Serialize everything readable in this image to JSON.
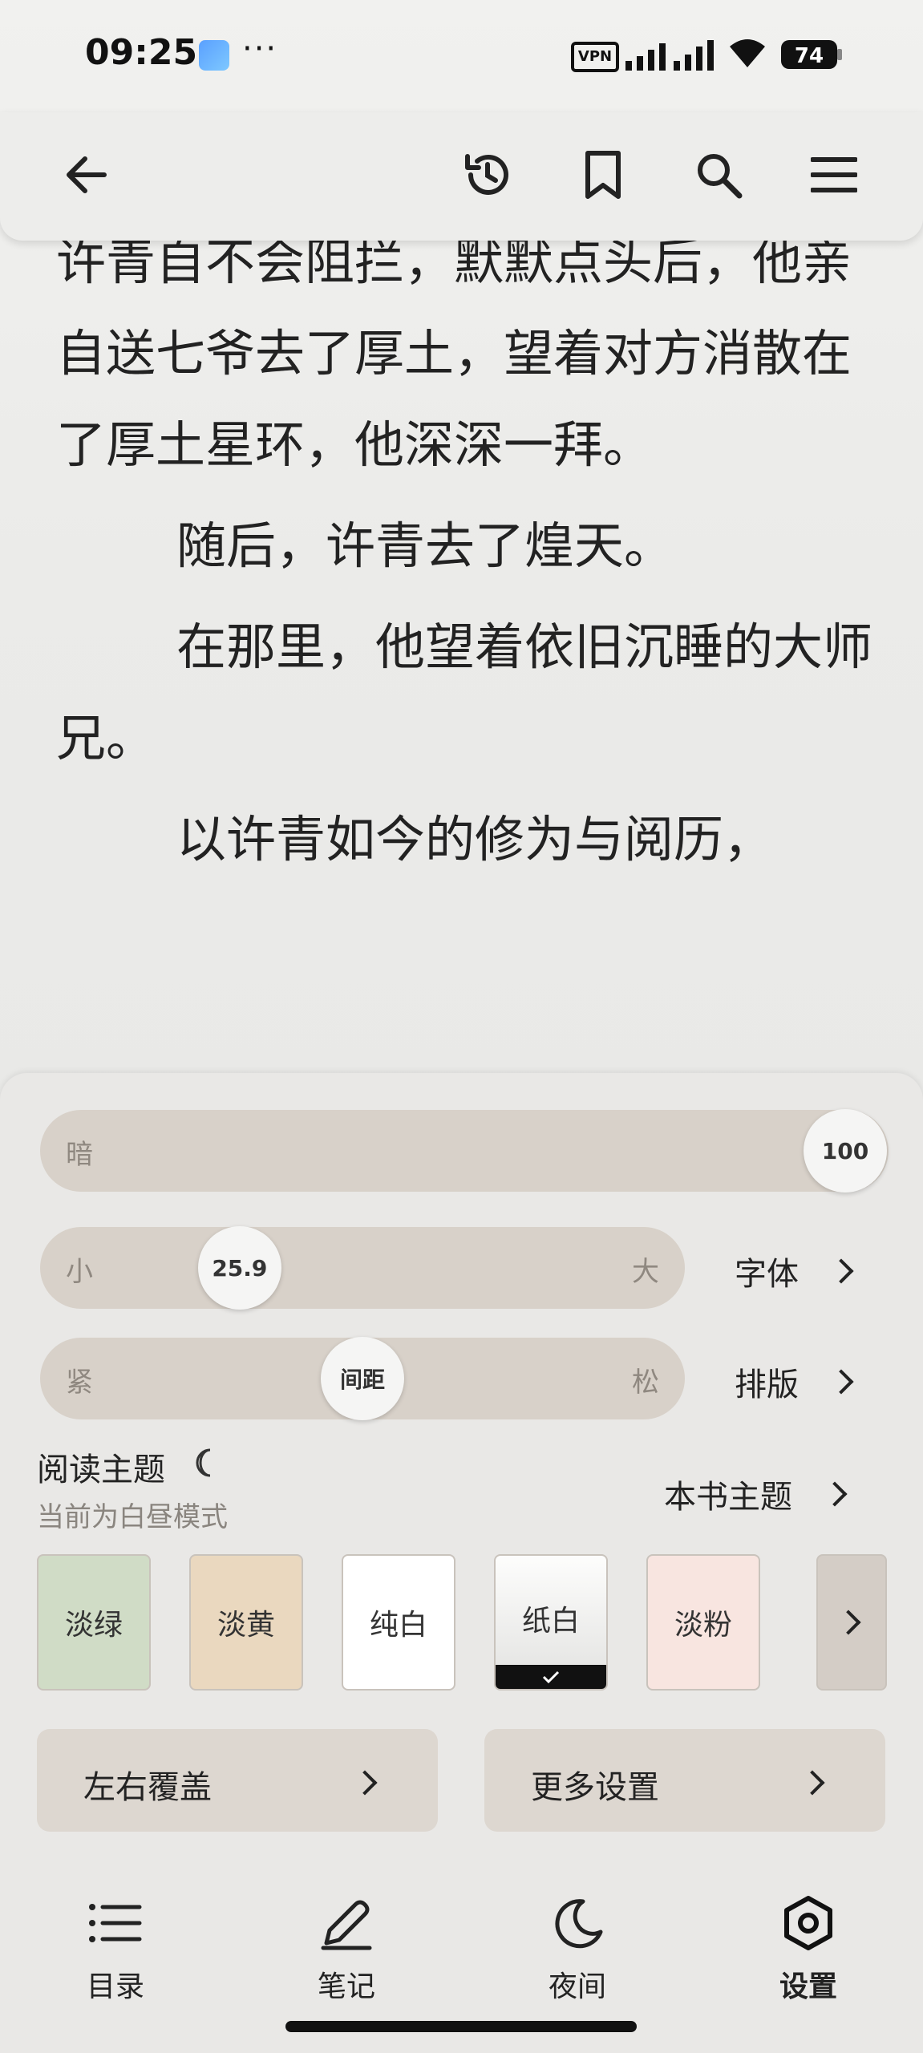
{
  "status_bar": {
    "time": "09:25",
    "vpn_label": "VPN",
    "battery": "74"
  },
  "top_bar": {
    "back_icon": "arrow-left-icon",
    "history_icon": "history-icon",
    "bookmark_icon": "bookmark-icon",
    "search_icon": "search-icon",
    "menu_icon": "menu-icon"
  },
  "reader": {
    "paragraphs": [
      {
        "text": "许青自不会阻拦，默默点头后，他亲自送七爷去了厚土，望着对方消散在了厚土星环，他深深一拜。",
        "indent": false
      },
      {
        "text": "随后，许青去了煌天。",
        "indent": true
      },
      {
        "text": "在那里，他望着依旧沉睡的大师兄。",
        "indent": true
      },
      {
        "text": "以许青如今的修为与阅历，",
        "indent": true
      }
    ]
  },
  "settings": {
    "brightness": {
      "label": "暗",
      "value": "100",
      "fraction": 1.0
    },
    "font_size": {
      "min_label": "小",
      "max_label": "大",
      "value": "25.9",
      "fraction": 0.28
    },
    "font_link": "字体",
    "spacing": {
      "min_label": "紧",
      "max_label": "松",
      "knob_label": "间距",
      "fraction": 0.5
    },
    "layout_link": "排版",
    "theme": {
      "title": "阅读主题",
      "subtitle": "当前为白昼模式",
      "book_theme_link": "本书主题",
      "swatches": [
        {
          "label": "淡绿",
          "color": "#d0dcc6",
          "selected": false
        },
        {
          "label": "淡黄",
          "color": "#ead8bf",
          "selected": false
        },
        {
          "label": "纯白",
          "color": "#ffffff",
          "selected": false
        },
        {
          "label": "纸白",
          "color": "#efefed",
          "selected": true
        },
        {
          "label": "淡粉",
          "color": "#f8e5e0",
          "selected": false
        }
      ]
    },
    "page_turn_button": "左右覆盖",
    "more_settings_button": "更多设置"
  },
  "bottom_nav": [
    {
      "label": "目录",
      "icon": "list-icon"
    },
    {
      "label": "笔记",
      "icon": "pen-icon"
    },
    {
      "label": "夜间",
      "icon": "moon-icon"
    },
    {
      "label": "设置",
      "icon": "settings-icon"
    }
  ]
}
